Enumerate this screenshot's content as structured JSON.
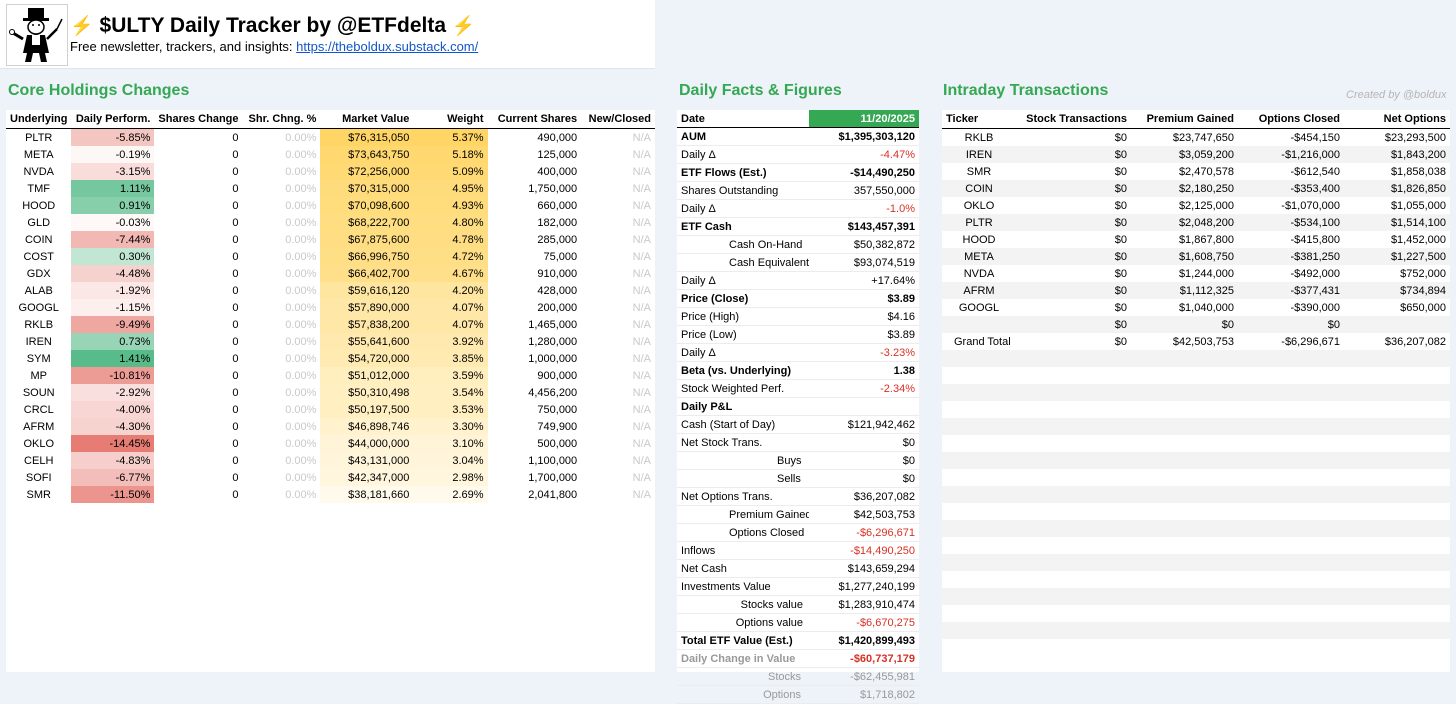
{
  "header": {
    "title": "$ULTY Daily Tracker by @ETFdelta",
    "bolt": "⚡",
    "subtitle_prefix": "Free newsletter, trackers, and insights: ",
    "link_text": "https://theboldux.substack.com/"
  },
  "holdings": {
    "title": "Core Holdings Changes",
    "columns": [
      "Underlying",
      "Daily Perform.",
      "Shares Change",
      "Shr. Chng. %",
      "Market Value",
      "Weight",
      "Current Shares",
      "New/Closed"
    ],
    "rows": [
      {
        "ticker": "PLTR",
        "perf": "-5.85%",
        "perf_val": -5.85,
        "shares_change": "0",
        "shr_pct": "0.00%",
        "market_value": "$76,315,050",
        "weight": "5.37%",
        "weight_val": 5.37,
        "current_shares": "490,000",
        "new_closed": "N/A"
      },
      {
        "ticker": "META",
        "perf": "-0.19%",
        "perf_val": -0.19,
        "shares_change": "0",
        "shr_pct": "0.00%",
        "market_value": "$73,643,750",
        "weight": "5.18%",
        "weight_val": 5.18,
        "current_shares": "125,000",
        "new_closed": "N/A"
      },
      {
        "ticker": "NVDA",
        "perf": "-3.15%",
        "perf_val": -3.15,
        "shares_change": "0",
        "shr_pct": "0.00%",
        "market_value": "$72,256,000",
        "weight": "5.09%",
        "weight_val": 5.09,
        "current_shares": "400,000",
        "new_closed": "N/A"
      },
      {
        "ticker": "TMF",
        "perf": "1.11%",
        "perf_val": 1.11,
        "shares_change": "0",
        "shr_pct": "0.00%",
        "market_value": "$70,315,000",
        "weight": "4.95%",
        "weight_val": 4.95,
        "current_shares": "1,750,000",
        "new_closed": "N/A"
      },
      {
        "ticker": "HOOD",
        "perf": "0.91%",
        "perf_val": 0.91,
        "shares_change": "0",
        "shr_pct": "0.00%",
        "market_value": "$70,098,600",
        "weight": "4.93%",
        "weight_val": 4.93,
        "current_shares": "660,000",
        "new_closed": "N/A"
      },
      {
        "ticker": "GLD",
        "perf": "-0.03%",
        "perf_val": -0.03,
        "shares_change": "0",
        "shr_pct": "0.00%",
        "market_value": "$68,222,700",
        "weight": "4.80%",
        "weight_val": 4.8,
        "current_shares": "182,000",
        "new_closed": "N/A"
      },
      {
        "ticker": "COIN",
        "perf": "-7.44%",
        "perf_val": -7.44,
        "shares_change": "0",
        "shr_pct": "0.00%",
        "market_value": "$67,875,600",
        "weight": "4.78%",
        "weight_val": 4.78,
        "current_shares": "285,000",
        "new_closed": "N/A"
      },
      {
        "ticker": "COST",
        "perf": "0.30%",
        "perf_val": 0.3,
        "shares_change": "0",
        "shr_pct": "0.00%",
        "market_value": "$66,996,750",
        "weight": "4.72%",
        "weight_val": 4.72,
        "current_shares": "75,000",
        "new_closed": "N/A"
      },
      {
        "ticker": "GDX",
        "perf": "-4.48%",
        "perf_val": -4.48,
        "shares_change": "0",
        "shr_pct": "0.00%",
        "market_value": "$66,402,700",
        "weight": "4.67%",
        "weight_val": 4.67,
        "current_shares": "910,000",
        "new_closed": "N/A"
      },
      {
        "ticker": "ALAB",
        "perf": "-1.92%",
        "perf_val": -1.92,
        "shares_change": "0",
        "shr_pct": "0.00%",
        "market_value": "$59,616,120",
        "weight": "4.20%",
        "weight_val": 4.2,
        "current_shares": "428,000",
        "new_closed": "N/A"
      },
      {
        "ticker": "GOOGL",
        "perf": "-1.15%",
        "perf_val": -1.15,
        "shares_change": "0",
        "shr_pct": "0.00%",
        "market_value": "$57,890,000",
        "weight": "4.07%",
        "weight_val": 4.07,
        "current_shares": "200,000",
        "new_closed": "N/A"
      },
      {
        "ticker": "RKLB",
        "perf": "-9.49%",
        "perf_val": -9.49,
        "shares_change": "0",
        "shr_pct": "0.00%",
        "market_value": "$57,838,200",
        "weight": "4.07%",
        "weight_val": 4.07,
        "current_shares": "1,465,000",
        "new_closed": "N/A"
      },
      {
        "ticker": "IREN",
        "perf": "0.73%",
        "perf_val": 0.73,
        "shares_change": "0",
        "shr_pct": "0.00%",
        "market_value": "$55,641,600",
        "weight": "3.92%",
        "weight_val": 3.92,
        "current_shares": "1,280,000",
        "new_closed": "N/A"
      },
      {
        "ticker": "SYM",
        "perf": "1.41%",
        "perf_val": 1.41,
        "shares_change": "0",
        "shr_pct": "0.00%",
        "market_value": "$54,720,000",
        "weight": "3.85%",
        "weight_val": 3.85,
        "current_shares": "1,000,000",
        "new_closed": "N/A"
      },
      {
        "ticker": "MP",
        "perf": "-10.81%",
        "perf_val": -10.81,
        "shares_change": "0",
        "shr_pct": "0.00%",
        "market_value": "$51,012,000",
        "weight": "3.59%",
        "weight_val": 3.59,
        "current_shares": "900,000",
        "new_closed": "N/A"
      },
      {
        "ticker": "SOUN",
        "perf": "-2.92%",
        "perf_val": -2.92,
        "shares_change": "0",
        "shr_pct": "0.00%",
        "market_value": "$50,310,498",
        "weight": "3.54%",
        "weight_val": 3.54,
        "current_shares": "4,456,200",
        "new_closed": "N/A"
      },
      {
        "ticker": "CRCL",
        "perf": "-4.00%",
        "perf_val": -4.0,
        "shares_change": "0",
        "shr_pct": "0.00%",
        "market_value": "$50,197,500",
        "weight": "3.53%",
        "weight_val": 3.53,
        "current_shares": "750,000",
        "new_closed": "N/A"
      },
      {
        "ticker": "AFRM",
        "perf": "-4.30%",
        "perf_val": -4.3,
        "shares_change": "0",
        "shr_pct": "0.00%",
        "market_value": "$46,898,746",
        "weight": "3.30%",
        "weight_val": 3.3,
        "current_shares": "749,900",
        "new_closed": "N/A"
      },
      {
        "ticker": "OKLO",
        "perf": "-14.45%",
        "perf_val": -14.45,
        "shares_change": "0",
        "shr_pct": "0.00%",
        "market_value": "$44,000,000",
        "weight": "3.10%",
        "weight_val": 3.1,
        "current_shares": "500,000",
        "new_closed": "N/A"
      },
      {
        "ticker": "CELH",
        "perf": "-4.83%",
        "perf_val": -4.83,
        "shares_change": "0",
        "shr_pct": "0.00%",
        "market_value": "$43,131,000",
        "weight": "3.04%",
        "weight_val": 3.04,
        "current_shares": "1,100,000",
        "new_closed": "N/A"
      },
      {
        "ticker": "SOFI",
        "perf": "-6.77%",
        "perf_val": -6.77,
        "shares_change": "0",
        "shr_pct": "0.00%",
        "market_value": "$42,347,000",
        "weight": "2.98%",
        "weight_val": 2.98,
        "current_shares": "1,700,000",
        "new_closed": "N/A"
      },
      {
        "ticker": "SMR",
        "perf": "-11.50%",
        "perf_val": -11.5,
        "shares_change": "0",
        "shr_pct": "0.00%",
        "market_value": "$38,181,660",
        "weight": "2.69%",
        "weight_val": 2.69,
        "current_shares": "2,041,800",
        "new_closed": "N/A"
      }
    ]
  },
  "facts": {
    "title": "Daily Facts & Figures",
    "date_label": "Date",
    "date_value": "11/20/2025",
    "rows": [
      {
        "label": "AUM",
        "value": "$1,395,303,120",
        "style": "strong topline"
      },
      {
        "label": "Daily Δ",
        "value": "-4.47%",
        "neg": true
      },
      {
        "label": "ETF Flows (Est.)",
        "value": "-$14,490,250",
        "style": "strong topline"
      },
      {
        "label": "Shares Outstanding",
        "value": "357,550,000"
      },
      {
        "label": "Daily Δ",
        "value": "-1.0%",
        "neg": true
      },
      {
        "label": "ETF Cash",
        "value": "$143,457,391",
        "style": "strong topline"
      },
      {
        "label": "Cash On-Hand",
        "value": "$50,382,872",
        "style": "ind1"
      },
      {
        "label": "Cash Equivalents",
        "value": "$93,074,519",
        "style": "ind1"
      },
      {
        "label": "Daily Δ",
        "value": "+17.64%"
      },
      {
        "label": "Price (Close)",
        "value": "$3.89",
        "style": "strong topline"
      },
      {
        "label": "Price (High)",
        "value": "$4.16"
      },
      {
        "label": "Price (Low)",
        "value": "$3.89"
      },
      {
        "label": "Daily Δ",
        "value": "-3.23%",
        "neg": true
      },
      {
        "label": "Beta (vs. Underlying)",
        "value": "1.38",
        "style": "strong topline"
      },
      {
        "label": "Stock Weighted Perf.",
        "value": "-2.34%",
        "neg": true
      },
      {
        "label": "Daily P&L",
        "value": "",
        "style": "strong topline"
      },
      {
        "label": "Cash (Start of Day)",
        "value": "$121,942,462"
      },
      {
        "label": "Net Stock Trans.",
        "value": "$0"
      },
      {
        "label": "Buys",
        "value": "$0",
        "style": "ind2 topline"
      },
      {
        "label": "Sells",
        "value": "$0",
        "style": "ind2"
      },
      {
        "label": "Net Options Trans.",
        "value": "$36,207,082",
        "style": "topline"
      },
      {
        "label": "Premium Gained",
        "value": "$42,503,753",
        "style": "ind1"
      },
      {
        "label": "Options Closed",
        "value": "-$6,296,671",
        "neg": true,
        "style": "ind1"
      },
      {
        "label": "Inflows",
        "value": "-$14,490,250",
        "neg": true,
        "style": "topline"
      },
      {
        "label": "Net Cash",
        "value": "$143,659,294",
        "style": "topline"
      },
      {
        "label": "Investments Value",
        "value": "$1,277,240,199"
      },
      {
        "label": "Stocks value",
        "value": "$1,283,910,474",
        "style": "ind1r"
      },
      {
        "label": "Options value",
        "value": "-$6,670,275",
        "neg": true,
        "style": "ind1r"
      },
      {
        "label": "Total ETF Value (Est.)",
        "value": "$1,420,899,493",
        "style": "strong topline"
      },
      {
        "label": "Daily Change in Value",
        "value": "-$60,737,179",
        "neg": true,
        "style": "strong grey topline"
      },
      {
        "label": "Stocks",
        "value": "-$62,455,981",
        "style": "grey indgrey"
      },
      {
        "label": "Options",
        "value": "$1,718,802",
        "style": "grey indgrey"
      }
    ]
  },
  "intraday": {
    "title": "Intraday Transactions",
    "created_by": "Created by @boldux",
    "columns": [
      "Ticker",
      "Stock Transactions",
      "Premium Gained",
      "Options Closed",
      "Net Options"
    ],
    "rows": [
      {
        "ticker": "RKLB",
        "stock": "$0",
        "premium": "$23,747,650",
        "closed": "-$454,150",
        "net": "$23,293,500"
      },
      {
        "ticker": "IREN",
        "stock": "$0",
        "premium": "$3,059,200",
        "closed": "-$1,216,000",
        "net": "$1,843,200"
      },
      {
        "ticker": "SMR",
        "stock": "$0",
        "premium": "$2,470,578",
        "closed": "-$612,540",
        "net": "$1,858,038"
      },
      {
        "ticker": "COIN",
        "stock": "$0",
        "premium": "$2,180,250",
        "closed": "-$353,400",
        "net": "$1,826,850"
      },
      {
        "ticker": "OKLO",
        "stock": "$0",
        "premium": "$2,125,000",
        "closed": "-$1,070,000",
        "net": "$1,055,000"
      },
      {
        "ticker": "PLTR",
        "stock": "$0",
        "premium": "$2,048,200",
        "closed": "-$534,100",
        "net": "$1,514,100"
      },
      {
        "ticker": "HOOD",
        "stock": "$0",
        "premium": "$1,867,800",
        "closed": "-$415,800",
        "net": "$1,452,000"
      },
      {
        "ticker": "META",
        "stock": "$0",
        "premium": "$1,608,750",
        "closed": "-$381,250",
        "net": "$1,227,500"
      },
      {
        "ticker": "NVDA",
        "stock": "$0",
        "premium": "$1,244,000",
        "closed": "-$492,000",
        "net": "$752,000"
      },
      {
        "ticker": "AFRM",
        "stock": "$0",
        "premium": "$1,112,325",
        "closed": "-$377,431",
        "net": "$734,894"
      },
      {
        "ticker": "GOOGL",
        "stock": "$0",
        "premium": "$1,040,000",
        "closed": "-$390,000",
        "net": "$650,000"
      },
      {
        "ticker": "",
        "stock": "$0",
        "premium": "$0",
        "closed": "$0",
        "net": ""
      },
      {
        "ticker": "Grand Total",
        "stock": "$0",
        "premium": "$42,503,753",
        "closed": "-$6,296,671",
        "net": "$36,207,082",
        "grand": true
      }
    ],
    "empty_rows": 17
  },
  "colors": {
    "section_green": "#34a853",
    "negative_red": "#d93025",
    "link_blue": "#1155cc",
    "weight_high": "#ffd666",
    "weight_low": "#fffaeb",
    "perf_pos": "#57bb8a",
    "perf_neg": "#e67c73"
  }
}
